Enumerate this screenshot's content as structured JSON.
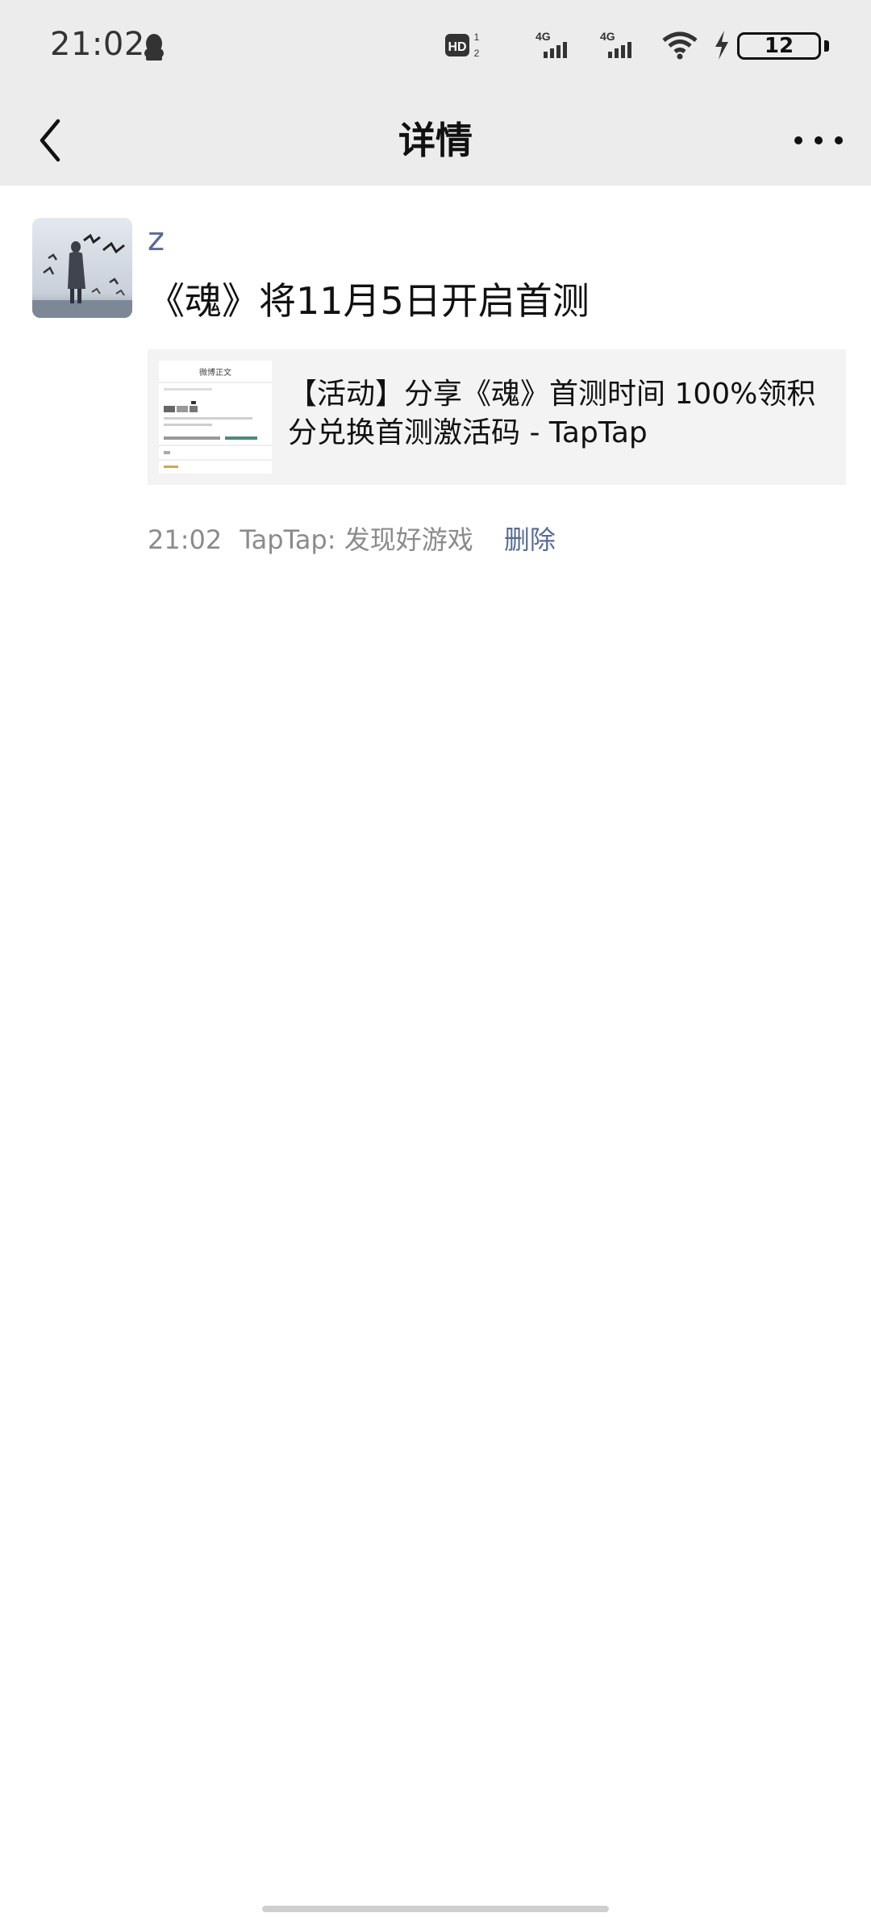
{
  "status_bar": {
    "time": "21:02",
    "battery": "12",
    "icons": [
      "qq-penguin-icon",
      "hd-voice-icon",
      "signal-4g-icon",
      "signal-4g-icon",
      "wifi-icon",
      "charging-bolt-icon",
      "battery-icon"
    ]
  },
  "nav": {
    "title": "详情",
    "back_icon": "chevron-left-icon",
    "more_icon": "more-dots-icon"
  },
  "post": {
    "username": "z",
    "text": "《魂》将11月5日开启首测",
    "link": {
      "title": "【活动】分享《魂》首测时间 100%领积分兑换首测激活码 - TapTap",
      "thumb_heading": "微博正文"
    },
    "meta": {
      "time": "21:02",
      "source": "TapTap: 发现好游戏",
      "delete_label": "删除"
    }
  },
  "colors": {
    "header_bg": "#ececec",
    "link_blue": "#576b95",
    "meta_gray": "#8b8b8b",
    "card_bg": "#f3f3f3"
  }
}
